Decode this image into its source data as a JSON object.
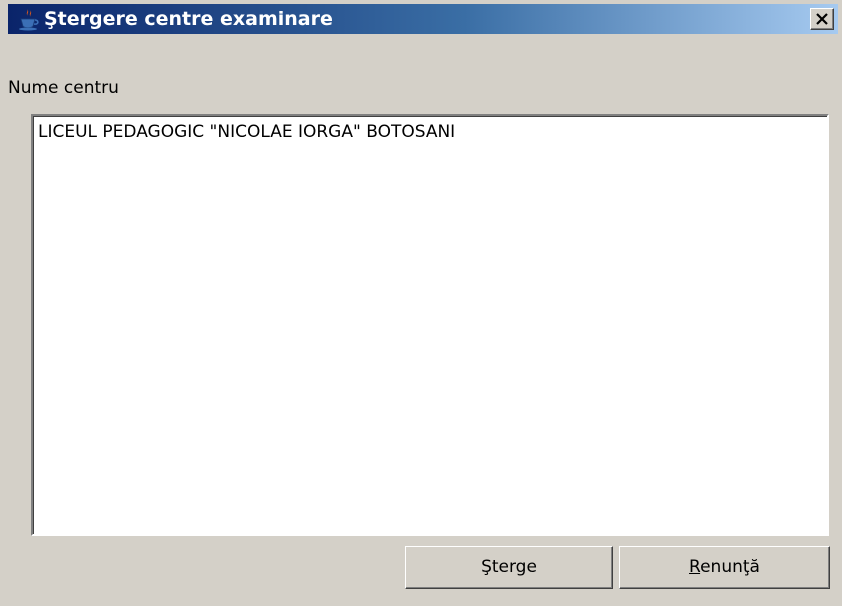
{
  "window": {
    "title": "Ştergere centre examinare",
    "icon": "java-cup-icon",
    "close_label": "close"
  },
  "form": {
    "field_label": "Nume centru",
    "field_value": "LICEUL PEDAGOGIC \"NICOLAE IORGA\" BOTOSANI"
  },
  "buttons": {
    "delete_label": "Şterge",
    "cancel_mnemonic": "R",
    "cancel_rest": "enunţă"
  },
  "colors": {
    "title_gradient_start": "#0a246a",
    "title_gradient_end": "#a6caf0",
    "dialog_background": "#d4d0c8"
  }
}
